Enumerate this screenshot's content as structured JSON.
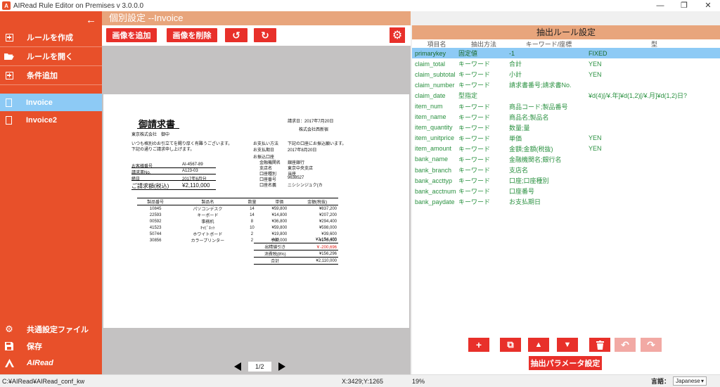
{
  "window": {
    "title": "AIRead Rule Editor on Premises v 3.0.0.0",
    "logo_text": "A",
    "minimize": "—",
    "maximize": "❐",
    "close": "✕"
  },
  "sidebar": {
    "back": "←",
    "items": [
      {
        "label": "ルールを作成",
        "icon": "add-square-icon"
      },
      {
        "label": "ルールを開く",
        "icon": "folder-open-icon"
      },
      {
        "label": "条件追加",
        "icon": "add-square-icon"
      }
    ],
    "documents": [
      {
        "label": "Invoice",
        "active": true
      },
      {
        "label": "Invoice2",
        "active": false
      }
    ],
    "bottom": [
      {
        "label": "共通設定ファイル",
        "icon": "gear-icon"
      },
      {
        "label": "保存",
        "icon": "save-icon"
      },
      {
        "label": "AIRead",
        "icon": "airead-logo-icon"
      }
    ]
  },
  "main": {
    "header": "個別設定 --Invoice",
    "toolbar": {
      "add_image": "画像を追加",
      "delete_image": "画像を削除",
      "rotate_left": "↺",
      "rotate_right": "↻",
      "settings": "⚙"
    },
    "pager": "1/2"
  },
  "invoice": {
    "title": "御請求書",
    "date": "請求日：2017年7月20日",
    "sender": "株式会社西新宿",
    "recipient": "東京株式会社　御中",
    "greeting1": "いつも格別のお引立てを賜り厚く有難うございます。",
    "greeting2": "下記の通りご請求申し上げます。",
    "info_rows": [
      {
        "k": "お客様番号",
        "v": "AI-4567-89"
      },
      {
        "k": "請求書No.",
        "v": "A123-03"
      },
      {
        "k": "締日",
        "v": "2017年6月分"
      }
    ],
    "total_label": "ご請求額(税込)",
    "total_value": "¥2,110,000",
    "pay_method_label": "お支払い方法",
    "pay_method": "下記の口座にお振込願います。",
    "pay_date_label": "お支払期日",
    "pay_date": "2017年8月20日",
    "bank_header": "お振込口座",
    "bank_rows": [
      {
        "k": "金融機関名",
        "v": "銀座銀行"
      },
      {
        "k": "支店名",
        "v": "東京中央支店"
      },
      {
        "k": "口座種別",
        "v": "当座"
      },
      {
        "k": "口座番号",
        "v": "9638527"
      },
      {
        "k": "口座名義",
        "v": "ニシシンジュク(カ"
      }
    ],
    "items_header": [
      "製品番号",
      "製品名",
      "数量",
      "単価",
      "金額(税抜)"
    ],
    "items": [
      [
        "10845",
        "パソコンデスク",
        "14",
        "¥59,800",
        "¥837,200"
      ],
      [
        "22593",
        "キーボード",
        "14",
        "¥14,800",
        "¥207,200"
      ],
      [
        "00592",
        "事務机",
        "8",
        "¥36,800",
        "¥294,400"
      ],
      [
        "41523",
        "ｷｬﾋﾞﾈｯﾄ",
        "10",
        "¥59,800",
        "¥598,000"
      ],
      [
        "50744",
        "ホワイトボード",
        "2",
        "¥19,800",
        "¥39,600"
      ],
      [
        "30856",
        "カラープリンター",
        "2",
        "¥89,000",
        "¥178,000"
      ]
    ],
    "summary": [
      {
        "k": "小計",
        "v": "¥2,154,400",
        "red": false
      },
      {
        "k": "出精値引き",
        "v": "￥-200,696",
        "red": true
      },
      {
        "k": "消費税(8%)",
        "v": "¥156,296",
        "red": false
      },
      {
        "k": "合計",
        "v": "¥2,110,000",
        "red": false
      }
    ]
  },
  "rules_panel": {
    "header": "抽出ルール設定",
    "columns": [
      "項目名",
      "抽出方法",
      "キーワード/座標",
      "型"
    ],
    "rows": [
      {
        "name": "primarykey",
        "method": "固定値",
        "keyword": "-1",
        "type": "FIXED",
        "selected": true
      },
      {
        "name": "claim_total",
        "method": "キーワード",
        "keyword": "合計",
        "type": "YEN"
      },
      {
        "name": "claim_subtotal",
        "method": "キーワード",
        "keyword": "小計",
        "type": "YEN"
      },
      {
        "name": "claim_number",
        "method": "キーワード",
        "keyword": "請求書番号;請求書No.",
        "type": ""
      },
      {
        "name": "claim_date",
        "method": "型指定",
        "keyword": "",
        "type": "¥d(4)[/¥.年]¥d(1,2)[/¥.月]¥d(1,2)日?"
      },
      {
        "name": "item_num",
        "method": "キーワード",
        "keyword": "商品コード;製品番号",
        "type": ""
      },
      {
        "name": "item_name",
        "method": "キーワード",
        "keyword": "商品名;製品名",
        "type": ""
      },
      {
        "name": "item_quantity",
        "method": "キーワード",
        "keyword": "数量;量",
        "type": ""
      },
      {
        "name": "item_unitprice",
        "method": "キーワード",
        "keyword": "単価",
        "type": "YEN"
      },
      {
        "name": "item_amount",
        "method": "キーワード",
        "keyword": "金額;金額(税抜)",
        "type": "YEN"
      },
      {
        "name": "bank_name",
        "method": "キーワード",
        "keyword": "金融機関名;銀行名",
        "type": ""
      },
      {
        "name": "bank_branch",
        "method": "キーワード",
        "keyword": "支店名",
        "type": ""
      },
      {
        "name": "bank_accttyp",
        "method": "キーワード",
        "keyword": "口座;口座種別",
        "type": ""
      },
      {
        "name": "bank_acctnum",
        "method": "キーワード",
        "keyword": "口座番号",
        "type": ""
      },
      {
        "name": "bank_paydate",
        "method": "キーワード",
        "keyword": "お支払期日",
        "type": ""
      }
    ],
    "buttons": {
      "add": "+",
      "copy": "⧉",
      "up": "▲",
      "down": "▼",
      "delete": "🗑",
      "undo": "↶",
      "redo": "↷"
    },
    "param_button": "抽出パラメータ設定"
  },
  "status": {
    "path": "C:¥AIRead¥AIRead_conf_kw",
    "coords": "X:3429;Y:1265",
    "zoom": "19%",
    "lang_label": "言語：",
    "lang_value": "Japanese",
    "lang_arrow": "▾"
  },
  "colors": {
    "sidebar": "#e8502a",
    "header": "#e8a57c",
    "button": "#e8302a",
    "selected": "#8dcaf5",
    "rule_text": "#2a9140"
  }
}
